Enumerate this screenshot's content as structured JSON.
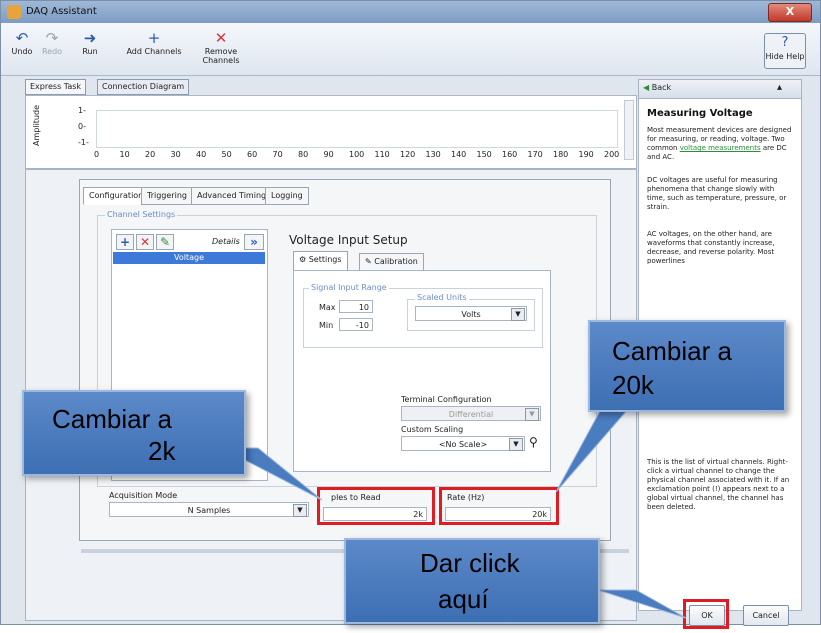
{
  "window": {
    "title": "DAQ Assistant",
    "close_glyph": "X"
  },
  "toolbar": {
    "undo": "Undo",
    "redo": "Redo",
    "run": "Run",
    "add_channels": "Add Channels",
    "remove_channels": "Remove Channels",
    "hide_help": "Hide Help"
  },
  "top_tabs": {
    "express": "Express Task",
    "connection": "Connection Diagram"
  },
  "graph": {
    "ylabel": "Amplitude",
    "yticks": [
      "1-",
      "0-",
      "-1-"
    ],
    "xticks": [
      "0",
      "10",
      "20",
      "30",
      "40",
      "50",
      "60",
      "70",
      "80",
      "90",
      "100",
      "110",
      "120",
      "130",
      "140",
      "150",
      "160",
      "170",
      "180",
      "190",
      "200"
    ]
  },
  "config_tabs": [
    "Configuration",
    "Triggering",
    "Advanced Timing",
    "Logging"
  ],
  "channel_settings": {
    "label": "Channel Settings",
    "details": "Details",
    "details_btn": "»",
    "item": "Voltage"
  },
  "voltage_setup": {
    "title": "Voltage Input Setup",
    "tab_settings": "Settings",
    "tab_calibration": "Calibration",
    "range_label": "Signal Input Range",
    "max_label": "Max",
    "max_value": "10",
    "min_label": "Min",
    "min_value": "-10",
    "scaled_units_label": "Scaled Units",
    "scaled_units_value": "Volts",
    "terminal_label": "Terminal Configuration",
    "terminal_value": "Differential",
    "custom_scaling_label": "Custom Scaling",
    "custom_scaling_value": "<No Scale>"
  },
  "timing": {
    "acq_mode_label": "Acquisition Mode",
    "acq_mode_value": "N Samples",
    "samples_label": "ples to Read",
    "samples_value": "2k",
    "rate_label": "Rate (Hz)",
    "rate_value": "20k"
  },
  "help": {
    "back": "Back",
    "title": "Measuring Voltage",
    "p1a": "Most measurement devices are designed for measuring, or reading, voltage. Two common",
    "p1link": "voltage measurements",
    "p1b": "are DC and AC.",
    "p2": "DC voltages are useful for measuring phenomena that change slowly with time, such as temperature, pressure, or strain.",
    "p3": "AC voltages, on the other hand, are waveforms that constantly increase, decrease, and reverse polarity. Most powerlines",
    "p4": "This is the list of virtual channels. Right-click a virtual channel to change the physical channel associated with it. If an exclamation point (!) appears next to a global virtual channel, the channel has been deleted."
  },
  "buttons": {
    "ok": "OK",
    "cancel": "Cancel"
  },
  "callouts": {
    "c1_line1": "Cambiar a",
    "c1_line2": "2k",
    "c2_line1": "Cambiar a",
    "c2_line2": "20k",
    "c3_line1": "Dar click",
    "c3_line2": "aquí"
  },
  "colors": {
    "highlight": "#e11b22",
    "callout": "#4a7cc0",
    "selection": "#3d79d8",
    "link": "#2a8f3a"
  },
  "icons": [
    "undo-icon",
    "redo-icon",
    "run-icon",
    "add-icon",
    "remove-icon",
    "help-icon",
    "back-icon",
    "add-channel-icon",
    "delete-channel-icon",
    "edit-channel-icon"
  ]
}
